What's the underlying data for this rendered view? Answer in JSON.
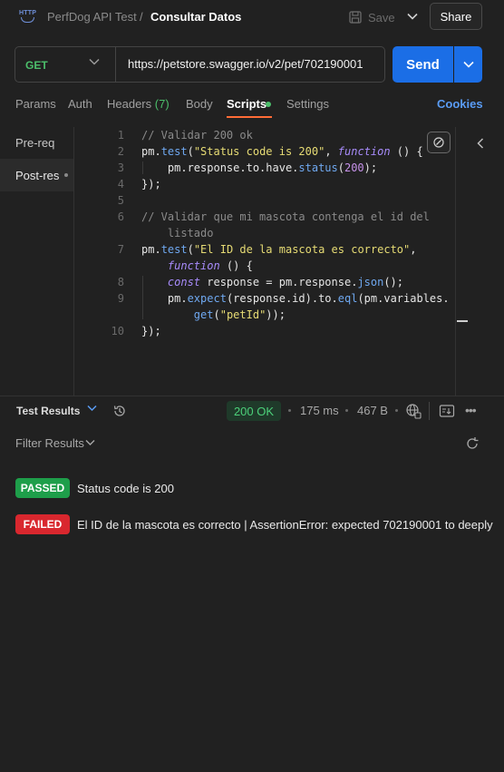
{
  "header": {
    "breadcrumb_parent": "PerfDog API Test",
    "breadcrumb_sep": "/",
    "breadcrumb_current": "Consultar Datos",
    "save_label": "Save",
    "share_label": "Share",
    "http_icon_label": "HTTP"
  },
  "request": {
    "method": "GET",
    "url": "https://petstore.swagger.io/v2/pet/702190001",
    "send_label": "Send"
  },
  "tabs": [
    {
      "label": "Params"
    },
    {
      "label": "Auth"
    },
    {
      "label": "Headers",
      "count": "(7)"
    },
    {
      "label": "Body"
    },
    {
      "label": "Scripts"
    },
    {
      "label": "Settings"
    }
  ],
  "cookies_label": "Cookies",
  "scripts_sidebar": {
    "items": [
      {
        "label": "Pre-req"
      },
      {
        "label": "Post-res"
      }
    ]
  },
  "code": {
    "line_numbers": [
      "1",
      "2",
      "3",
      "4",
      "5",
      "6",
      "7",
      "8",
      "9",
      "10"
    ],
    "lines": [
      "// Validar 200 ok",
      "pm.test(\"Status code is 200\", function () {",
      "    pm.response.to.have.status(200);",
      "});",
      "",
      "// Validar que mi mascota contenga el id del",
      "    listado",
      "pm.test(\"El ID de la mascota es correcto\",",
      "    function () {",
      "    const response = pm.response.json();",
      "    pm.expect(response.id).to.eql(pm.variables.",
      "        get(\"petId\"));",
      "});"
    ]
  },
  "results": {
    "title": "Test Results",
    "status": "200 OK",
    "time": "175 ms",
    "size": "467 B",
    "filter_label": "Filter Results",
    "items": [
      {
        "status": "PASSED",
        "text": "Status code is 200"
      },
      {
        "status": "FAILED",
        "text": "El ID de la mascota es correcto | AssertionError: expected 702190001 to deeply"
      }
    ]
  },
  "colors": {
    "accent_orange": "#ff6c37",
    "send_blue": "#1b6ee6",
    "pass_green": "#1e9e4a",
    "fail_red": "#d9272e",
    "method_green": "#4cbf6b"
  }
}
